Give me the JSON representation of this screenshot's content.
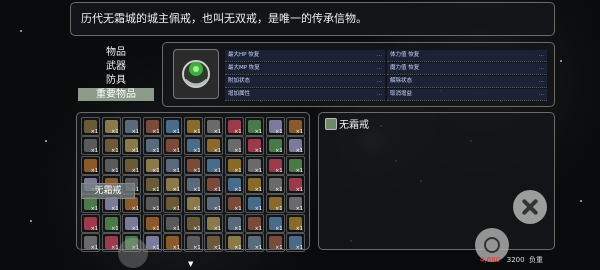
{
  "description": {
    "text": "历代无霜城的城主佩戒，也叫无双戒，是唯一的传承信物。"
  },
  "categories": [
    {
      "label": "物品",
      "selected": false
    },
    {
      "label": "武器",
      "selected": false
    },
    {
      "label": "防具",
      "selected": false
    },
    {
      "label": "重要物品",
      "selected": true
    }
  ],
  "equip": {
    "stats_left": [
      "最大HP 恢复",
      "最大MP 恢复",
      "附加状态",
      "增加属性"
    ],
    "stats_right": [
      "体力值 恢复",
      "魔力值 恢复",
      "解除状态",
      "取消增益"
    ],
    "dots": "..."
  },
  "grid": {
    "quantity_label": "×1",
    "tooltip": "无霜戒"
  },
  "detail": {
    "item_name": "无霜戒"
  },
  "weight": {
    "current": "4,680",
    "max": "3200",
    "label": "负重"
  },
  "icons": {
    "close": "close-icon",
    "confirm": "circle-icon"
  }
}
